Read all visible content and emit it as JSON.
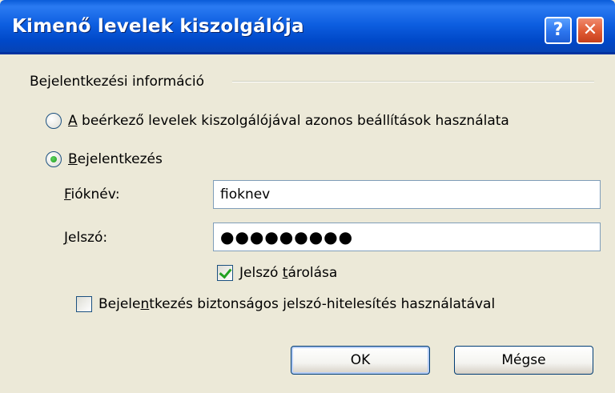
{
  "window": {
    "title": "Kimenő levelek kiszolgálója",
    "help_label": "?",
    "close_label": "✕"
  },
  "group": {
    "label": "Bejelentkezési információ"
  },
  "options": {
    "same_settings": {
      "access_key": "A",
      "rest": " beérkező levelek kiszolgálójával azonos beállítások használata",
      "selected": false
    },
    "login": {
      "access_key": "B",
      "rest": "ejelentkezés",
      "selected": true
    }
  },
  "fields": {
    "account": {
      "access_key": "F",
      "rest": "iókné v:",
      "label_display": "Fióknév:",
      "value": "fioknev"
    },
    "password": {
      "access_key": "J",
      "rest": "elszó:",
      "value": "●●●●●●●●●"
    }
  },
  "remember_password": {
    "before": "Jelszó ",
    "access_key": "t",
    "after": "árolása",
    "checked": true
  },
  "spa": {
    "before": "Bejele",
    "access_key": "n",
    "after": "tkezés biztonságos jelszó-hitelesítés használatával",
    "checked": false
  },
  "buttons": {
    "ok": "OK",
    "cancel": "Mégse"
  }
}
